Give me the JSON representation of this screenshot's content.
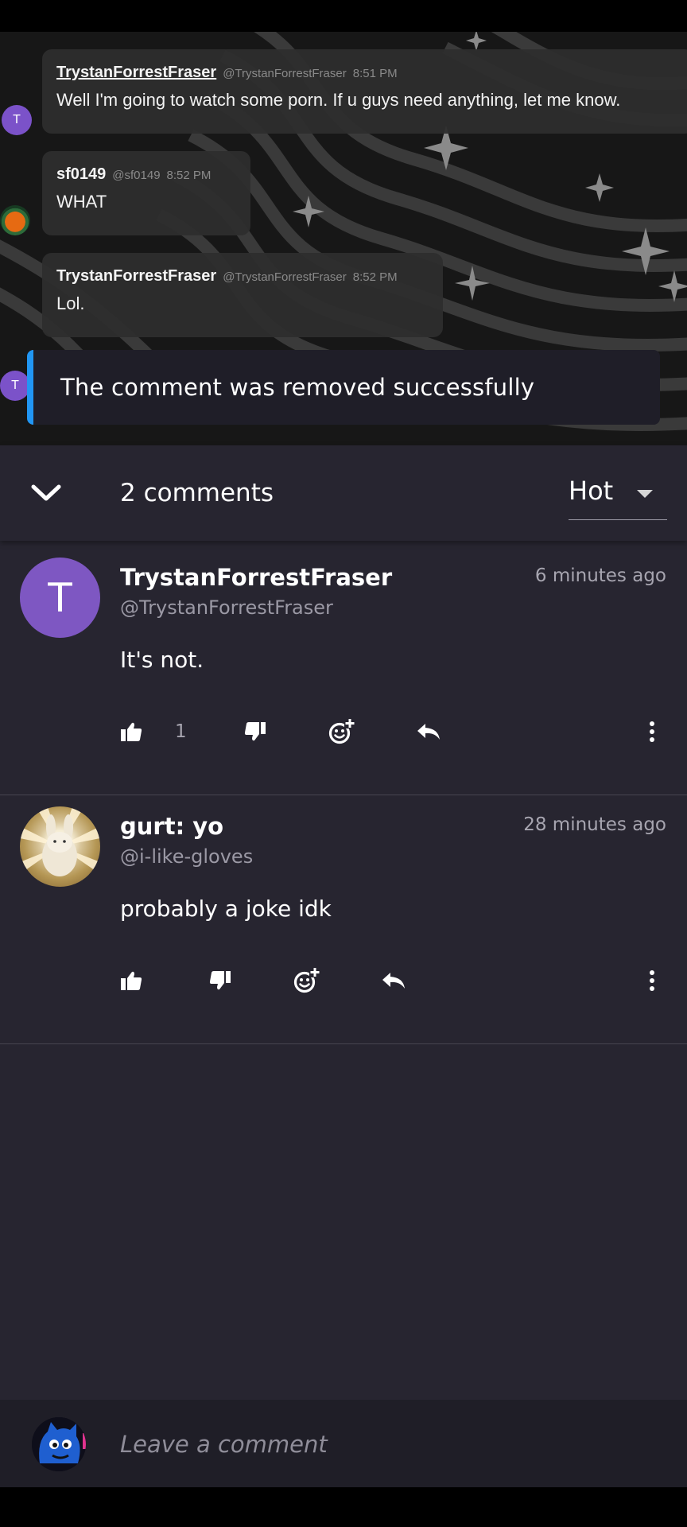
{
  "chat": {
    "messages": [
      {
        "name": "TrystanForrestFraser",
        "handle": "@TrystanForrestFraser",
        "time": "8:51 PM",
        "text": "Well I'm going to watch some porn. If u guys need anything, let me know.",
        "avatar_letter": "T"
      },
      {
        "name": "sf0149",
        "handle": "@sf0149",
        "time": "8:52 PM",
        "text": "WHAT"
      },
      {
        "name": "TrystanForrestFraser",
        "handle": "@TrystanForrestFraser",
        "time": "8:52 PM",
        "text": "Lol.",
        "avatar_letter": "T"
      }
    ]
  },
  "toast": {
    "text": "The comment was removed successfully",
    "accent": "#2196f3"
  },
  "header": {
    "comment_count": "2 comments",
    "sort_value": "Hot"
  },
  "comments": [
    {
      "author": "TrystanForrestFraser",
      "handle": "@TrystanForrestFraser",
      "time": "6 minutes ago",
      "text": "It's not.",
      "avatar_letter": "T",
      "likes": "1"
    },
    {
      "author": "gurt: yo",
      "handle": "@i-like-gloves",
      "time": "28 minutes ago",
      "text": "probably a joke idk"
    }
  ],
  "composer": {
    "placeholder": "Leave a comment"
  },
  "colors": {
    "sheet_bg": "#272530",
    "avatar_purple": "#7e57c2",
    "toast_bg": "#1f1e28"
  },
  "icons": [
    "chevron-down-icon",
    "thumbs-up-icon",
    "thumbs-down-icon",
    "add-reaction-icon",
    "reply-icon",
    "more-vertical-icon",
    "caret-down-icon"
  ]
}
